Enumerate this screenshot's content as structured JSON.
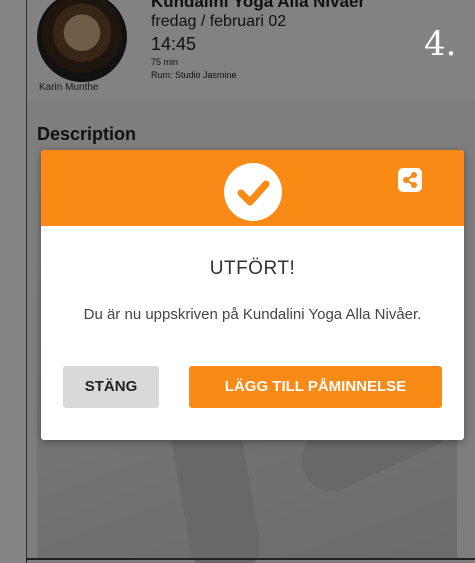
{
  "step": {
    "number": "4."
  },
  "class": {
    "title": "Kundalini Yoga Alla Nivåer",
    "date": "fredag / februari 02",
    "time": "14:45",
    "duration": "75 min",
    "room": "Rum: Studio Jasmine",
    "instructor": "Karin Munthe"
  },
  "description": {
    "heading": "Description"
  },
  "dialog": {
    "status_icon": "check-circle-icon",
    "share_icon": "share-icon",
    "title": "UTFÖRT!",
    "message": "Du är nu uppskriven på Kundalini Yoga Alla Nivåer.",
    "close_label": "STÄNG",
    "reminder_label": "LÄGG TILL PÅMINNELSE"
  },
  "colors": {
    "accent": "#f98a16",
    "overlay": "rgba(0,0,0,0.48)",
    "secondary_button": "#d9d9d9"
  }
}
